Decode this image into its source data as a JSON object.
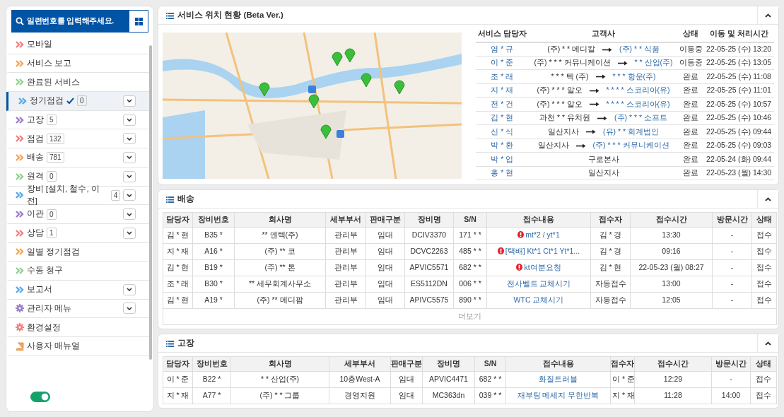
{
  "search": {
    "placeholder": "일련번호를 입력해주세요."
  },
  "sidebar": {
    "items": [
      {
        "label": "모바일",
        "kind": "chevrons",
        "color": "#f08080",
        "dropdown": false,
        "selected": false,
        "checked": false
      },
      {
        "label": "서비스 보고",
        "kind": "chevrons",
        "color": "#f5a55a",
        "dropdown": false,
        "selected": false,
        "checked": false
      },
      {
        "label": "완료된 서비스",
        "kind": "chevrons",
        "color": "#8fd18f",
        "dropdown": false,
        "selected": false,
        "checked": false
      },
      {
        "label": "정기점검",
        "kind": "chevrons",
        "color": "#5aa9e6",
        "count": "0",
        "dropdown": true,
        "selected": true,
        "checked": true
      },
      {
        "label": "고장",
        "kind": "chevrons",
        "color": "#9b7cc9",
        "count": "5",
        "dropdown": true,
        "selected": false,
        "checked": false
      },
      {
        "label": "점검",
        "kind": "chevrons",
        "color": "#f08080",
        "count": "132",
        "dropdown": true,
        "selected": false,
        "checked": false
      },
      {
        "label": "배송",
        "kind": "chevrons",
        "color": "#f5a55a",
        "count": "781",
        "dropdown": true,
        "selected": false,
        "checked": false
      },
      {
        "label": "원격",
        "kind": "chevrons",
        "color": "#8fd18f",
        "count": "0",
        "dropdown": true,
        "selected": false,
        "checked": false
      },
      {
        "label": "장비 [설치, 철수, 이전]",
        "kind": "chevrons",
        "color": "#5aa9e6",
        "count": "4",
        "dropdown": true,
        "selected": false,
        "checked": false
      },
      {
        "label": "이관",
        "kind": "chevrons",
        "color": "#9b7cc9",
        "count": "0",
        "dropdown": true,
        "selected": false,
        "checked": false
      },
      {
        "label": "상담",
        "kind": "chevrons",
        "color": "#f08080",
        "count": "1",
        "dropdown": true,
        "selected": false,
        "checked": false
      },
      {
        "label": "일별 정기점검",
        "kind": "chevrons",
        "color": "#f5a55a",
        "dropdown": false,
        "selected": false,
        "checked": false
      },
      {
        "label": "수동 청구",
        "kind": "chevrons",
        "color": "#8fd18f",
        "dropdown": false,
        "selected": false,
        "checked": false
      },
      {
        "label": "보고서",
        "kind": "chevrons",
        "color": "#5aa9e6",
        "dropdown": true,
        "selected": false,
        "checked": false
      },
      {
        "label": "관리자 메뉴",
        "kind": "gear",
        "color": "#9b7cc9",
        "dropdown": true,
        "selected": false,
        "checked": false
      },
      {
        "label": "환경설정",
        "kind": "gear",
        "color": "#f08080",
        "dropdown": false,
        "selected": false,
        "checked": false
      },
      {
        "label": "사용자 매뉴얼",
        "kind": "book",
        "color": "#f5a55a",
        "dropdown": false,
        "selected": false,
        "checked": false
      }
    ],
    "toggle": {
      "on": true
    }
  },
  "location": {
    "title": "서비스 위치 현황 (Beta Ver.)",
    "table": {
      "columns": [
        "서비스 담당자",
        "고객사",
        "상태",
        "이동 및 처리시간"
      ],
      "rows": [
        {
          "agent": "염 * 규",
          "from": "(주) * * 메디칼",
          "to": "(주) * * 식품",
          "status": "이동중",
          "time": "22-05-25 (수) 13:20"
        },
        {
          "agent": "이 * 준",
          "from": "(주) * * * 커뮤니케이션",
          "to": "* * 산업(주)",
          "status": "이동중",
          "time": "22-05-25 (수) 13:05"
        },
        {
          "agent": "조 * 래",
          "from": "* * * 텍 (주)",
          "to": "* * * 항운(주)",
          "status": "완료",
          "time": "22-05-25 (수) 11:08"
        },
        {
          "agent": "지 * 재",
          "from": "(주) * * * 알오",
          "to": "* * * * 스코리아(유)",
          "status": "완료",
          "time": "22-05-25 (수) 11:01"
        },
        {
          "agent": "전 * 건",
          "from": "(주) * * * 알오",
          "to": "* * * * 스코리아(유)",
          "status": "완료",
          "time": "22-05-25 (수) 10:57"
        },
        {
          "agent": "김 * 현",
          "from": "과천 * * 유치원",
          "to": "(주) * * * 소프트",
          "status": "완료",
          "time": "22-05-25 (수) 10:46"
        },
        {
          "agent": "신 * 식",
          "from": "일산지사",
          "to": "(유) * * 회계법인",
          "status": "완료",
          "time": "22-05-25 (수) 09:44"
        },
        {
          "agent": "박 * 환",
          "from": "일산지사",
          "to": "(주) * * * 커뮤니케이션",
          "status": "완료",
          "time": "22-05-25 (수) 09:03"
        },
        {
          "agent": "박 * 업",
          "from": "구로본사",
          "status": "완료",
          "time": "22-05-24 (화) 09:44"
        },
        {
          "agent": "홍 * 현",
          "from": "일산지사",
          "status": "완료",
          "time": "22-05-23 (월) 14:30"
        }
      ]
    }
  },
  "delivery": {
    "title": "배송",
    "columns": [
      "담당자",
      "장비번호",
      "회사명",
      "세부부서",
      "판매구분",
      "장비명",
      "S/N",
      "접수내용",
      "접수자",
      "접수시간",
      "방문시간",
      "상태"
    ],
    "rows": [
      {
        "cells": [
          "김 * 현",
          "B35 *",
          "** 엔텍(주)",
          "관리부",
          "임대",
          "DCIV3370",
          "171 * *",
          "mt*2 / yt*1",
          "김 * 경",
          "13:30",
          "-",
          "접수"
        ],
        "urgent": true
      },
      {
        "cells": [
          "지 * 재",
          "A16 *",
          "(주) ** 코",
          "관리부",
          "임대",
          "DCVC2263",
          "485 * *",
          "[택배] Kt*1 Ct*1 Yt*1...",
          "김 * 경",
          "09:16",
          "-",
          "접수"
        ],
        "urgent": true
      },
      {
        "cells": [
          "김 * 현",
          "B19 *",
          "(주) ** 톤",
          "관리부",
          "임대",
          "APVIC5571",
          "682 * *",
          "kt여분요청",
          "김 * 현",
          "22-05-23 (월) 08:27",
          "-",
          "접수"
        ],
        "urgent": true
      },
      {
        "cells": [
          "조 * 래",
          "B30 *",
          "** 세무회계사무소",
          "관리부",
          "임대",
          "ES5112DN",
          "006 * *",
          "전사벨트 교체시기",
          "자동접수",
          "13:00",
          "-",
          "접수"
        ],
        "urgent": false
      },
      {
        "cells": [
          "김 * 현",
          "A19 *",
          "(주) ** 메디팜",
          "관리부",
          "임대",
          "APIVC5575",
          "890 * *",
          "WTC 교체시기",
          "자동접수",
          "12:05",
          "-",
          "접수"
        ],
        "urgent": false
      }
    ],
    "more": "더보기"
  },
  "breakdown": {
    "title": "고장",
    "columns": [
      "담당자",
      "장비번호",
      "회사명",
      "세부부서",
      "판매구분",
      "장비명",
      "S/N",
      "접수내용",
      "접수자",
      "접수시간",
      "방문시간",
      "상태"
    ],
    "rows": [
      {
        "cells": [
          "이 * 준",
          "B22 *",
          "* * 산업(주)",
          "10층West-A",
          "임대",
          "APVIC4471",
          "682 * *",
          "화질트러블",
          "이 * 준",
          "12:29",
          "-",
          "접수"
        ],
        "urgent": false
      },
      {
        "cells": [
          "지 * 재",
          "A77 *",
          "(주) * * 그룹",
          "경영지원",
          "임대",
          "MC363dn",
          "039 * *",
          "재부팅 메세지 무한반복",
          "지 * 재",
          "11:28",
          "14:00",
          "접수"
        ],
        "urgent": false
      }
    ]
  }
}
